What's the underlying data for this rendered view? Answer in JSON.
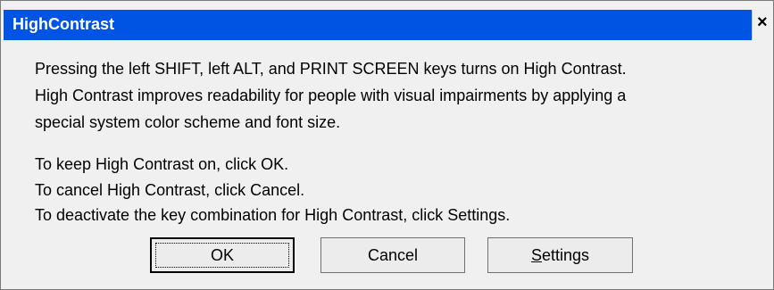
{
  "dialog": {
    "title": "HighContrast",
    "close_label": "×",
    "message_lines": [
      "Pressing the left SHIFT, left ALT, and PRINT SCREEN keys turns on High Contrast.",
      "High Contrast improves readability for people with visual impairments by applying a",
      "special system color scheme and font size.",
      "To keep High Contrast on, click OK.",
      "To cancel High Contrast, click Cancel.",
      "To deactivate the key combination for High Contrast, click Settings."
    ],
    "buttons": {
      "ok_label": "OK",
      "cancel_label": "Cancel",
      "settings_mnemonic": "S",
      "settings_rest": "ettings"
    },
    "colors": {
      "titlebar": "#0054e3",
      "dialog_bg": "#f0f0f0"
    }
  }
}
